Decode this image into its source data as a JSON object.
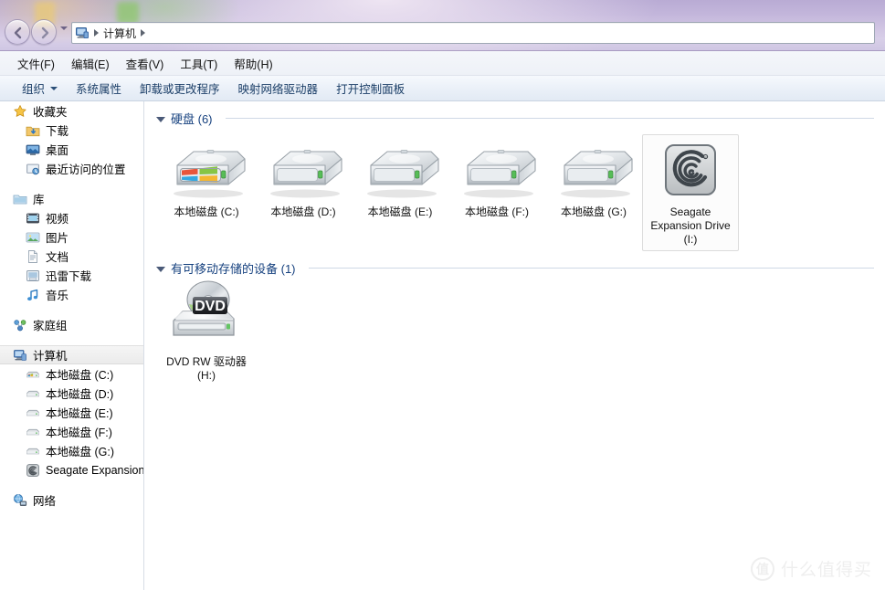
{
  "window": {
    "breadcrumb_icon": "computer-icon",
    "breadcrumb": "计算机"
  },
  "menubar": {
    "items": [
      {
        "label": "文件(F)",
        "name": "menu-file"
      },
      {
        "label": "编辑(E)",
        "name": "menu-edit"
      },
      {
        "label": "查看(V)",
        "name": "menu-view"
      },
      {
        "label": "工具(T)",
        "name": "menu-tools"
      },
      {
        "label": "帮助(H)",
        "name": "menu-help"
      }
    ]
  },
  "toolbar": {
    "organize": "组织",
    "items": [
      {
        "label": "系统属性",
        "name": "toolbar-system-properties"
      },
      {
        "label": "卸载或更改程序",
        "name": "toolbar-uninstall-change-program"
      },
      {
        "label": "映射网络驱动器",
        "name": "toolbar-map-network-drive"
      },
      {
        "label": "打开控制面板",
        "name": "toolbar-open-control-panel"
      }
    ]
  },
  "sidebar": {
    "groups": [
      {
        "header": {
          "label": "收藏夹",
          "icon": "star-icon",
          "name": "sidebar-group-favorites"
        },
        "items": [
          {
            "label": "下载",
            "icon": "download-folder-icon",
            "name": "sidebar-item-downloads"
          },
          {
            "label": "桌面",
            "icon": "desktop-icon",
            "name": "sidebar-item-desktop"
          },
          {
            "label": "最近访问的位置",
            "icon": "recent-places-icon",
            "name": "sidebar-item-recent-places"
          }
        ]
      },
      {
        "header": {
          "label": "库",
          "icon": "library-icon",
          "name": "sidebar-group-libraries"
        },
        "items": [
          {
            "label": "视频",
            "icon": "video-icon",
            "name": "sidebar-item-videos"
          },
          {
            "label": "图片",
            "icon": "pictures-icon",
            "name": "sidebar-item-pictures"
          },
          {
            "label": "文档",
            "icon": "documents-icon",
            "name": "sidebar-item-documents"
          },
          {
            "label": "迅雷下载",
            "icon": "thunder-download-icon",
            "name": "sidebar-item-thunder-download"
          },
          {
            "label": "音乐",
            "icon": "music-icon",
            "name": "sidebar-item-music"
          }
        ]
      },
      {
        "header": {
          "label": "家庭组",
          "icon": "homegroup-icon",
          "name": "sidebar-group-homegroup"
        },
        "items": []
      },
      {
        "header": {
          "label": "计算机",
          "icon": "computer-icon",
          "name": "sidebar-group-computer",
          "selected": true
        },
        "items": [
          {
            "label": "本地磁盘 (C:)",
            "icon": "system-drive-icon",
            "name": "sidebar-item-drive-c"
          },
          {
            "label": "本地磁盘 (D:)",
            "icon": "drive-icon",
            "name": "sidebar-item-drive-d"
          },
          {
            "label": "本地磁盘 (E:)",
            "icon": "drive-icon",
            "name": "sidebar-item-drive-e"
          },
          {
            "label": "本地磁盘 (F:)",
            "icon": "drive-icon",
            "name": "sidebar-item-drive-f"
          },
          {
            "label": "本地磁盘 (G:)",
            "icon": "drive-icon",
            "name": "sidebar-item-drive-g"
          },
          {
            "label": "Seagate Expansion",
            "icon": "seagate-icon",
            "name": "sidebar-item-seagate"
          }
        ]
      },
      {
        "header": {
          "label": "网络",
          "icon": "network-icon",
          "name": "sidebar-group-network"
        },
        "items": []
      }
    ]
  },
  "main": {
    "sections": [
      {
        "title": "硬盘 (6)",
        "name": "section-hard-disks",
        "tiles": [
          {
            "caption": "本地磁盘 (C:)",
            "icon": "system-drive-icon",
            "name": "drive-tile-c",
            "hovered": false
          },
          {
            "caption": "本地磁盘 (D:)",
            "icon": "drive-icon",
            "name": "drive-tile-d",
            "hovered": false
          },
          {
            "caption": "本地磁盘 (E:)",
            "icon": "drive-icon",
            "name": "drive-tile-e",
            "hovered": false
          },
          {
            "caption": "本地磁盘 (F:)",
            "icon": "drive-icon",
            "name": "drive-tile-f",
            "hovered": false
          },
          {
            "caption": "本地磁盘 (G:)",
            "icon": "drive-icon",
            "name": "drive-tile-g",
            "hovered": false
          },
          {
            "caption": "Seagate Expansion Drive (I:)",
            "icon": "seagate-icon",
            "name": "drive-tile-seagate",
            "hovered": true
          }
        ]
      },
      {
        "title": "有可移动存储的设备 (1)",
        "name": "section-removable-storage",
        "tiles": [
          {
            "caption": "DVD RW 驱动器 (H:)",
            "icon": "dvd-drive-icon",
            "name": "drive-tile-dvd",
            "hovered": false
          }
        ]
      }
    ]
  },
  "watermark": {
    "badge": "值",
    "text": "什么值得买"
  },
  "colors": {
    "accent": "#16417f",
    "toolbar_text": "#1c3f68",
    "glass": "#cfc3e2"
  }
}
